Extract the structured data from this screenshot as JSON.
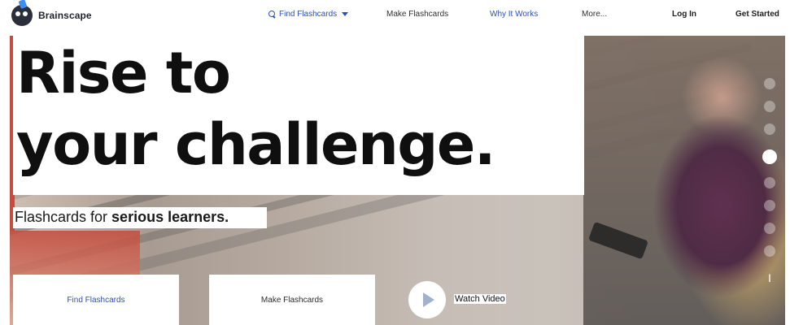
{
  "brand": {
    "name": "Brainscape"
  },
  "nav": {
    "find_flashcards": "Find Flashcards",
    "make_flashcards": "Make Flashcards",
    "why_it_works": "Why It Works",
    "more": "More...",
    "login": "Log In",
    "get_started": "Get Started"
  },
  "hero": {
    "headline_line1": "Rise to",
    "headline_line2": "your challenge.",
    "subline_regular": "Flashcards for ",
    "subline_bold": "serious learners.",
    "cta_find": "Find Flashcards",
    "cta_make": "Make Flashcards",
    "watch_video": "Watch Video"
  },
  "icons": {
    "search": "search-icon",
    "caret": "chevron-down-icon",
    "play": "play-icon"
  },
  "colors": {
    "accent_blue": "#2d4fb8",
    "text_dark": "#0f0f0f"
  }
}
